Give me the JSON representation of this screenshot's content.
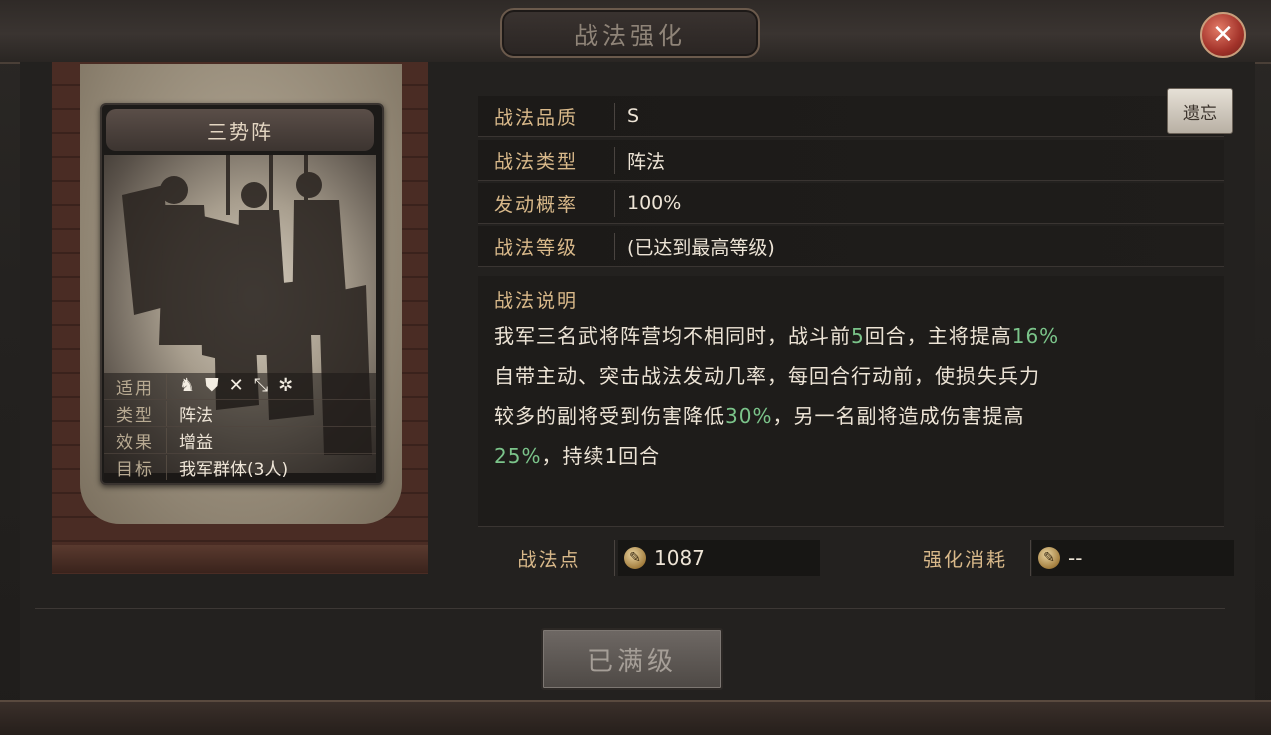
{
  "window": {
    "title": "战法强化",
    "close_icon": "close-icon"
  },
  "card": {
    "name": "三势阵",
    "props": [
      {
        "key": "适用",
        "icons": [
          "cavalry-icon",
          "shield-icon",
          "bow-icon",
          "spear-icon",
          "wheel-icon"
        ]
      },
      {
        "key": "类型",
        "value": "阵法"
      },
      {
        "key": "效果",
        "value": "增益"
      },
      {
        "key": "目标",
        "value": "我军群体(3人)"
      }
    ]
  },
  "info": {
    "quality": {
      "label": "战法品质",
      "value": "S"
    },
    "type": {
      "label": "战法类型",
      "value": "阵法"
    },
    "rate": {
      "label": "发动概率",
      "value": "100%"
    },
    "level": {
      "label": "战法等级",
      "value": "(已达到最高等级)"
    },
    "forget_label": "遗忘"
  },
  "description": {
    "title": "战法说明",
    "line1_a": "我军三名武将阵营均不相同时，战斗前",
    "line1_n1": "5",
    "line1_b": "回合，主将提高",
    "line1_n2": "16%",
    "line2": "自带主动、突击战法发动几率，每回合行动前，使损失兵力",
    "line3_a": "较多的副将受到伤害降低",
    "line3_n": "30%",
    "line3_b": "，另一名副将造成伤害提高",
    "line4_n": "25%",
    "line4_b": "，持续1回合"
  },
  "points": {
    "label": "战法点",
    "value": "1087"
  },
  "cost": {
    "label": "强化消耗",
    "value": "--"
  },
  "action": {
    "label": "已满级"
  },
  "colors": {
    "highlight": "#7bc48a",
    "label_gold": "#d9b98a"
  }
}
